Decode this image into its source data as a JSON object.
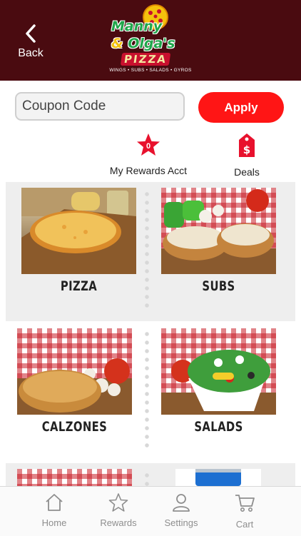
{
  "header": {
    "back_label": "Back",
    "logo": {
      "line1": "Manny",
      "amp": "&",
      "line2": "Olga's",
      "pizza": "PIZZA",
      "tagline": "WINGS • SUBS • SALADS • GYROS"
    }
  },
  "coupon": {
    "placeholder": "Coupon Code",
    "apply_label": "Apply"
  },
  "quick_actions": {
    "rewards": {
      "label": "My Rewards Acct",
      "points": "0"
    },
    "deals": {
      "label": "Deals"
    }
  },
  "categories": [
    {
      "label": "PIZZA"
    },
    {
      "label": "SUBS"
    },
    {
      "label": "CALZONES"
    },
    {
      "label": "SALADS"
    }
  ],
  "tabs": [
    {
      "label": "Home",
      "icon": "home-icon"
    },
    {
      "label": "Rewards",
      "icon": "star-icon"
    },
    {
      "label": "Settings",
      "icon": "person-icon"
    },
    {
      "label": "Cart",
      "icon": "cart-icon"
    }
  ],
  "colors": {
    "header_bg": "#4a0b10",
    "accent_red": "#ff1515",
    "tab_gray": "#8e8e8e"
  }
}
